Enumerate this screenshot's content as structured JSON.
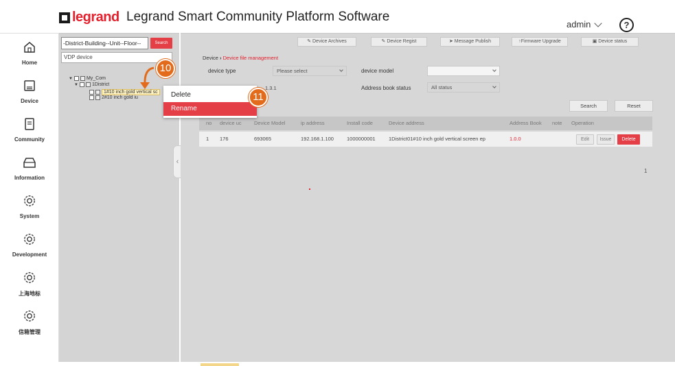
{
  "header": {
    "logo_text": "legrand",
    "title": "Legrand Smart Community Platform Software",
    "user": "admin",
    "help_label": "?"
  },
  "sidebar": {
    "items": [
      {
        "label": "Home",
        "icon": "home-icon"
      },
      {
        "label": "Device",
        "icon": "device-icon"
      },
      {
        "label": "Community",
        "icon": "community-icon"
      },
      {
        "label": "Information",
        "icon": "information-icon"
      },
      {
        "label": "System",
        "icon": "gear-icon"
      },
      {
        "label": "Development",
        "icon": "gear-icon"
      },
      {
        "label": "上海地标",
        "icon": "gear-icon"
      },
      {
        "label": "信箱管理",
        "icon": "gear-icon"
      }
    ]
  },
  "tree": {
    "search_value": "-District-Building--Unit--Floor--",
    "search_button": "Search",
    "device_type": "VDP device",
    "nodes": [
      "My_Com",
      "1District",
      "1#10 inch gold vertical sc",
      "2#10 inch gold iu"
    ]
  },
  "toolbar": {
    "buttons": [
      "Device Archives",
      "Device Regist",
      "Message Publish",
      "Firmware Upgrade",
      "Device status"
    ]
  },
  "breadcrumb": {
    "root": "Device",
    "current": "Device file management"
  },
  "filters": {
    "device_type_label": "device type",
    "device_type_value": "Please select",
    "device_model_label": "device model",
    "device_model_value": "",
    "version_value": "1.3.1",
    "address_book_label": "Address book status",
    "address_book_value": "All status",
    "search_button": "Search",
    "reset_button": "Reset"
  },
  "table": {
    "headers": [
      "no",
      "device uc",
      "Device Model",
      "ip address",
      "Install code",
      "Device address",
      "Address Book",
      "note",
      "Operation"
    ],
    "rows": [
      {
        "no": "1",
        "device_uc": "176",
        "model": "693065",
        "ip": "192.168.1.100",
        "install_code": "1000000001",
        "address": "1District01#10 inch gold vertical screen ep",
        "address_book": "1.0.0",
        "note": "",
        "ops": [
          "Edit",
          "Issue",
          "Delete"
        ]
      }
    ]
  },
  "pagination": {
    "page": "1"
  },
  "context_menu": {
    "items": [
      "Delete",
      "Rename"
    ],
    "highlighted": "Rename"
  },
  "annotations": {
    "step_a": "10",
    "step_b": "11"
  },
  "colors": {
    "brand_red": "#e4202d",
    "callout_orange": "#e26b1c",
    "panel_gray": "#d7d7d7"
  }
}
